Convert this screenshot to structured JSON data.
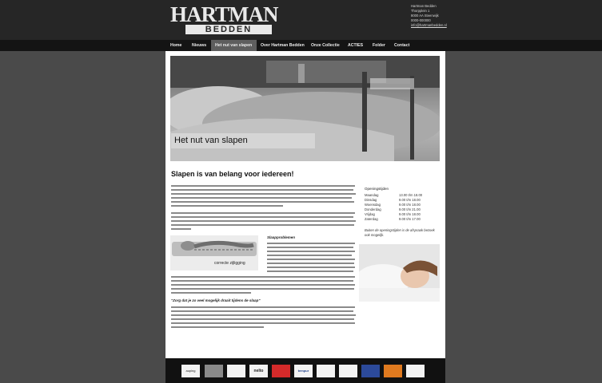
{
  "header": {
    "logo_line1": "HARTMAN",
    "logo_line2": "BEDDEN",
    "contact_lines": [
      "Hartman Bedden",
      "Thorpplein 1",
      "8000 AA Steenwijk",
      "0000-000000",
      "info@hartmanbedden.nl"
    ]
  },
  "nav": {
    "items": [
      {
        "label": "Home",
        "active": false
      },
      {
        "label": "Nieuws",
        "active": false
      },
      {
        "label": "Het nut van slapen",
        "active": true
      },
      {
        "label": "Over Hartman Bedden",
        "active": false
      },
      {
        "label": "Onze Collectie",
        "active": false
      },
      {
        "label": "ACTIES",
        "active": false
      },
      {
        "label": "Folder",
        "active": false
      },
      {
        "label": "Contact",
        "active": false
      }
    ]
  },
  "hero": {
    "caption": "Het nut van slapen"
  },
  "main": {
    "heading": "Slapen is van belang voor iedereen!",
    "subheading": "Slaapproblemen",
    "figure_caption": "correcte zijligging",
    "quote": "\"Zorg dat je zo veel mogelijk draait tijdens de slaap\""
  },
  "sidebar": {
    "title": "Openingstijden",
    "hours": [
      {
        "day": "Maandag",
        "time": "13.00 t/m 18.00"
      },
      {
        "day": "Dinsdag",
        "time": "9.00 t/m 18.00"
      },
      {
        "day": "Woensdag",
        "time": "9.00 t/m 18.00"
      },
      {
        "day": "Donderdag",
        "time": "9.00 t/m 21.00"
      },
      {
        "day": "Vrijdag",
        "time": "9.00 t/m 18.00"
      },
      {
        "day": "Zaterdag",
        "time": "9.00 t/m 17.00"
      }
    ],
    "note": "Buiten de openingstijden is de afspraak bezoek ook mogelijk."
  },
  "footer": {
    "brands": [
      "auping",
      "",
      "",
      "nelto",
      "",
      "tempur",
      "",
      "",
      "",
      "",
      ""
    ]
  },
  "colors": {
    "top_bar": "#262626",
    "nav_bar": "#141414",
    "nav_active": "#5e5e5e",
    "page_bg": "#4a4a4a"
  }
}
